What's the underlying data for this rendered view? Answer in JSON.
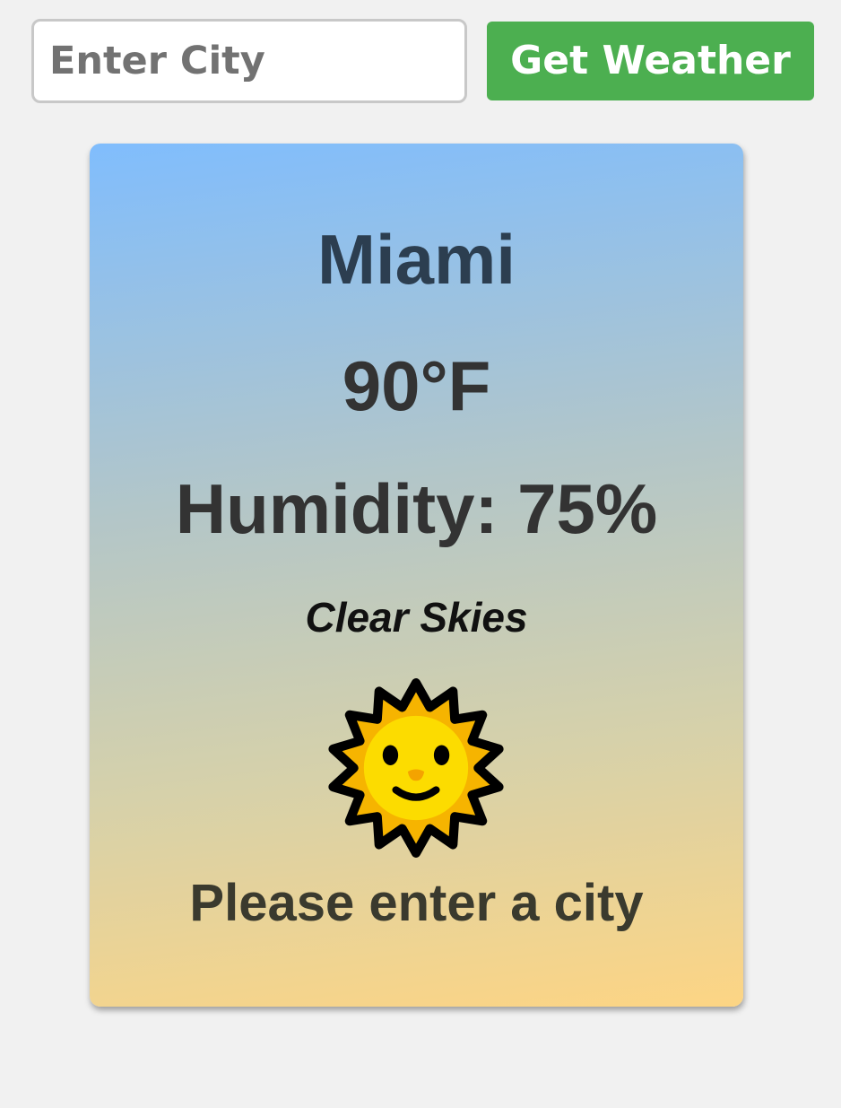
{
  "search": {
    "placeholder": "Enter City",
    "value": ""
  },
  "toolbar": {
    "get_weather_label": "Get Weather"
  },
  "weather": {
    "city": "Miami",
    "temperature": "90°F",
    "humidity": "Humidity: 75%",
    "condition": "Clear Skies",
    "icon": "sun-with-face-icon",
    "message": "Please enter a city"
  },
  "colors": {
    "button": "#4caf50",
    "card_top": "#80bdfd",
    "card_bottom": "#fdd584",
    "city_text": "#2c3e50"
  }
}
